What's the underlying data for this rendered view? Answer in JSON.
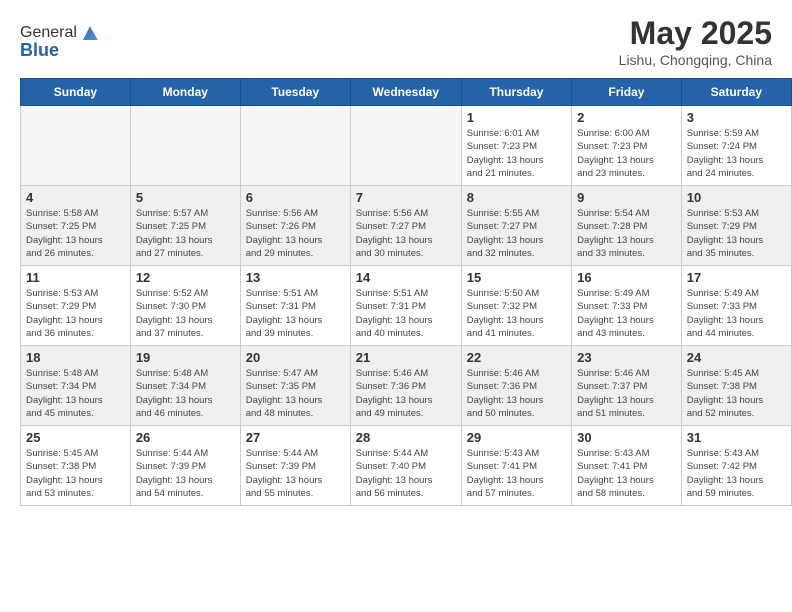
{
  "header": {
    "logo_general": "General",
    "logo_blue": "Blue",
    "title": "May 2025",
    "subtitle": "Lishu, Chongqing, China"
  },
  "days_of_week": [
    "Sunday",
    "Monday",
    "Tuesday",
    "Wednesday",
    "Thursday",
    "Friday",
    "Saturday"
  ],
  "weeks": [
    [
      {
        "num": "",
        "info": "",
        "empty": true
      },
      {
        "num": "",
        "info": "",
        "empty": true
      },
      {
        "num": "",
        "info": "",
        "empty": true
      },
      {
        "num": "",
        "info": "",
        "empty": true
      },
      {
        "num": "1",
        "info": "Sunrise: 6:01 AM\nSunset: 7:23 PM\nDaylight: 13 hours\nand 21 minutes.",
        "empty": false
      },
      {
        "num": "2",
        "info": "Sunrise: 6:00 AM\nSunset: 7:23 PM\nDaylight: 13 hours\nand 23 minutes.",
        "empty": false
      },
      {
        "num": "3",
        "info": "Sunrise: 5:59 AM\nSunset: 7:24 PM\nDaylight: 13 hours\nand 24 minutes.",
        "empty": false
      }
    ],
    [
      {
        "num": "4",
        "info": "Sunrise: 5:58 AM\nSunset: 7:25 PM\nDaylight: 13 hours\nand 26 minutes.",
        "empty": false
      },
      {
        "num": "5",
        "info": "Sunrise: 5:57 AM\nSunset: 7:25 PM\nDaylight: 13 hours\nand 27 minutes.",
        "empty": false
      },
      {
        "num": "6",
        "info": "Sunrise: 5:56 AM\nSunset: 7:26 PM\nDaylight: 13 hours\nand 29 minutes.",
        "empty": false
      },
      {
        "num": "7",
        "info": "Sunrise: 5:56 AM\nSunset: 7:27 PM\nDaylight: 13 hours\nand 30 minutes.",
        "empty": false
      },
      {
        "num": "8",
        "info": "Sunrise: 5:55 AM\nSunset: 7:27 PM\nDaylight: 13 hours\nand 32 minutes.",
        "empty": false
      },
      {
        "num": "9",
        "info": "Sunrise: 5:54 AM\nSunset: 7:28 PM\nDaylight: 13 hours\nand 33 minutes.",
        "empty": false
      },
      {
        "num": "10",
        "info": "Sunrise: 5:53 AM\nSunset: 7:29 PM\nDaylight: 13 hours\nand 35 minutes.",
        "empty": false
      }
    ],
    [
      {
        "num": "11",
        "info": "Sunrise: 5:53 AM\nSunset: 7:29 PM\nDaylight: 13 hours\nand 36 minutes.",
        "empty": false
      },
      {
        "num": "12",
        "info": "Sunrise: 5:52 AM\nSunset: 7:30 PM\nDaylight: 13 hours\nand 37 minutes.",
        "empty": false
      },
      {
        "num": "13",
        "info": "Sunrise: 5:51 AM\nSunset: 7:31 PM\nDaylight: 13 hours\nand 39 minutes.",
        "empty": false
      },
      {
        "num": "14",
        "info": "Sunrise: 5:51 AM\nSunset: 7:31 PM\nDaylight: 13 hours\nand 40 minutes.",
        "empty": false
      },
      {
        "num": "15",
        "info": "Sunrise: 5:50 AM\nSunset: 7:32 PM\nDaylight: 13 hours\nand 41 minutes.",
        "empty": false
      },
      {
        "num": "16",
        "info": "Sunrise: 5:49 AM\nSunset: 7:33 PM\nDaylight: 13 hours\nand 43 minutes.",
        "empty": false
      },
      {
        "num": "17",
        "info": "Sunrise: 5:49 AM\nSunset: 7:33 PM\nDaylight: 13 hours\nand 44 minutes.",
        "empty": false
      }
    ],
    [
      {
        "num": "18",
        "info": "Sunrise: 5:48 AM\nSunset: 7:34 PM\nDaylight: 13 hours\nand 45 minutes.",
        "empty": false
      },
      {
        "num": "19",
        "info": "Sunrise: 5:48 AM\nSunset: 7:34 PM\nDaylight: 13 hours\nand 46 minutes.",
        "empty": false
      },
      {
        "num": "20",
        "info": "Sunrise: 5:47 AM\nSunset: 7:35 PM\nDaylight: 13 hours\nand 48 minutes.",
        "empty": false
      },
      {
        "num": "21",
        "info": "Sunrise: 5:46 AM\nSunset: 7:36 PM\nDaylight: 13 hours\nand 49 minutes.",
        "empty": false
      },
      {
        "num": "22",
        "info": "Sunrise: 5:46 AM\nSunset: 7:36 PM\nDaylight: 13 hours\nand 50 minutes.",
        "empty": false
      },
      {
        "num": "23",
        "info": "Sunrise: 5:46 AM\nSunset: 7:37 PM\nDaylight: 13 hours\nand 51 minutes.",
        "empty": false
      },
      {
        "num": "24",
        "info": "Sunrise: 5:45 AM\nSunset: 7:38 PM\nDaylight: 13 hours\nand 52 minutes.",
        "empty": false
      }
    ],
    [
      {
        "num": "25",
        "info": "Sunrise: 5:45 AM\nSunset: 7:38 PM\nDaylight: 13 hours\nand 53 minutes.",
        "empty": false
      },
      {
        "num": "26",
        "info": "Sunrise: 5:44 AM\nSunset: 7:39 PM\nDaylight: 13 hours\nand 54 minutes.",
        "empty": false
      },
      {
        "num": "27",
        "info": "Sunrise: 5:44 AM\nSunset: 7:39 PM\nDaylight: 13 hours\nand 55 minutes.",
        "empty": false
      },
      {
        "num": "28",
        "info": "Sunrise: 5:44 AM\nSunset: 7:40 PM\nDaylight: 13 hours\nand 56 minutes.",
        "empty": false
      },
      {
        "num": "29",
        "info": "Sunrise: 5:43 AM\nSunset: 7:41 PM\nDaylight: 13 hours\nand 57 minutes.",
        "empty": false
      },
      {
        "num": "30",
        "info": "Sunrise: 5:43 AM\nSunset: 7:41 PM\nDaylight: 13 hours\nand 58 minutes.",
        "empty": false
      },
      {
        "num": "31",
        "info": "Sunrise: 5:43 AM\nSunset: 7:42 PM\nDaylight: 13 hours\nand 59 minutes.",
        "empty": false
      }
    ]
  ]
}
